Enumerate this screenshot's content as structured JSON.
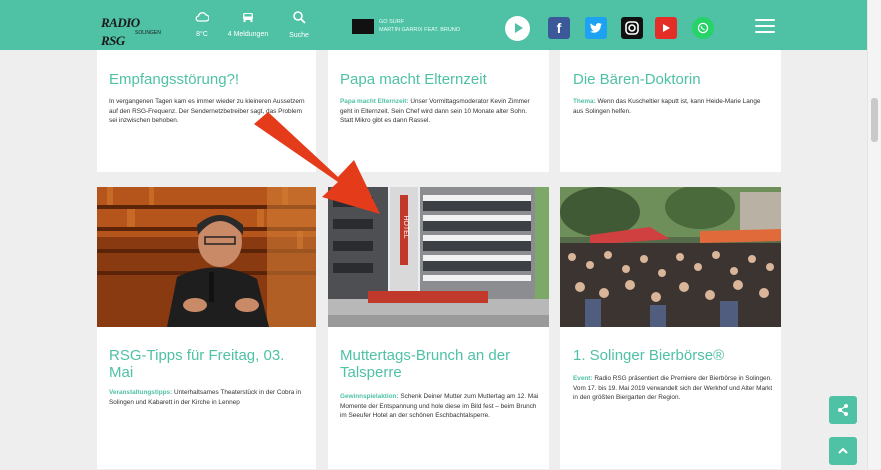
{
  "header": {
    "logo": "RADIO RSG",
    "logo_sub": "SOLINGEN",
    "tools": [
      {
        "icon": "cloud-icon",
        "label": "8°C"
      },
      {
        "icon": "car-icon",
        "label": "4 Meldungen"
      },
      {
        "icon": "search-icon",
        "label": "Suche"
      }
    ],
    "now_playing": {
      "line1": "GO SURF",
      "line2": "MARTIN GARRIX FEAT. BRUNO"
    },
    "social": [
      {
        "name": "facebook-icon",
        "glyph": "f",
        "color": "#3b5998"
      },
      {
        "name": "twitter-icon",
        "glyph": "t",
        "color": "#1da1f2"
      },
      {
        "name": "instagram-icon",
        "glyph": "◎",
        "color": "#111111"
      },
      {
        "name": "youtube-icon",
        "glyph": "▶",
        "color": "#e52d27"
      },
      {
        "name": "whatsapp-icon",
        "glyph": "✆",
        "color": "#25d366"
      }
    ]
  },
  "articles_top": [
    {
      "title": "Empfangsstörung?!",
      "keyword": "",
      "text": "In vergangenen Tagen kam es immer wieder zu kleineren Aussetzern auf den RSG-Frequenz. Der Sendernetzbetreiber sagt, das Problem sei inzwischen behoben."
    },
    {
      "title": "Papa macht Elternzeit",
      "keyword": "Papa macht Elternzeit:",
      "text": "Unser Vormittagsmoderator Kevin Zimmer geht in Elternzeit. Sein Chef wird dann sein 10 Monate alter Sohn. Statt Mikro gibt es dann Rassel."
    },
    {
      "title": "Die Bären-Doktorin",
      "keyword": "Thema:",
      "text": "Wenn das Kuscheltier kaputt ist, kann Heide-Marie Lange aus Solingen helfen."
    }
  ],
  "articles_bottom": [
    {
      "title": "RSG-Tipps für Freitag, 03. Mai",
      "keyword": "Veranstaltungstipps:",
      "text": "Unterhaltsames Theaterstück in der Cobra in Solingen und Kabarett in der Kirche in Lennep"
    },
    {
      "title": "Muttertags-Brunch an der Talsperre",
      "keyword": "Gewinnspielaktion:",
      "text": "Schenk Deiner Mutter zum Muttertag am 12. Mai Momente der Entspannung und hole diese im Bild fest – beim Brunch im Seeufer Hotel an der schönen Eschbachtalsperre."
    },
    {
      "title": "1. Solinger Bierbörse®",
      "keyword": "Event:",
      "text": "Radio RSG präsentiert die Premiere der Bierbörse in Solingen. Vom 17. bis 19. Mai 2019 verwandelt sich der Werkhof und Alter Markt in den größten Biergarten der Region."
    }
  ],
  "image_label": "HOTEL",
  "accent": "#4fc1a5"
}
